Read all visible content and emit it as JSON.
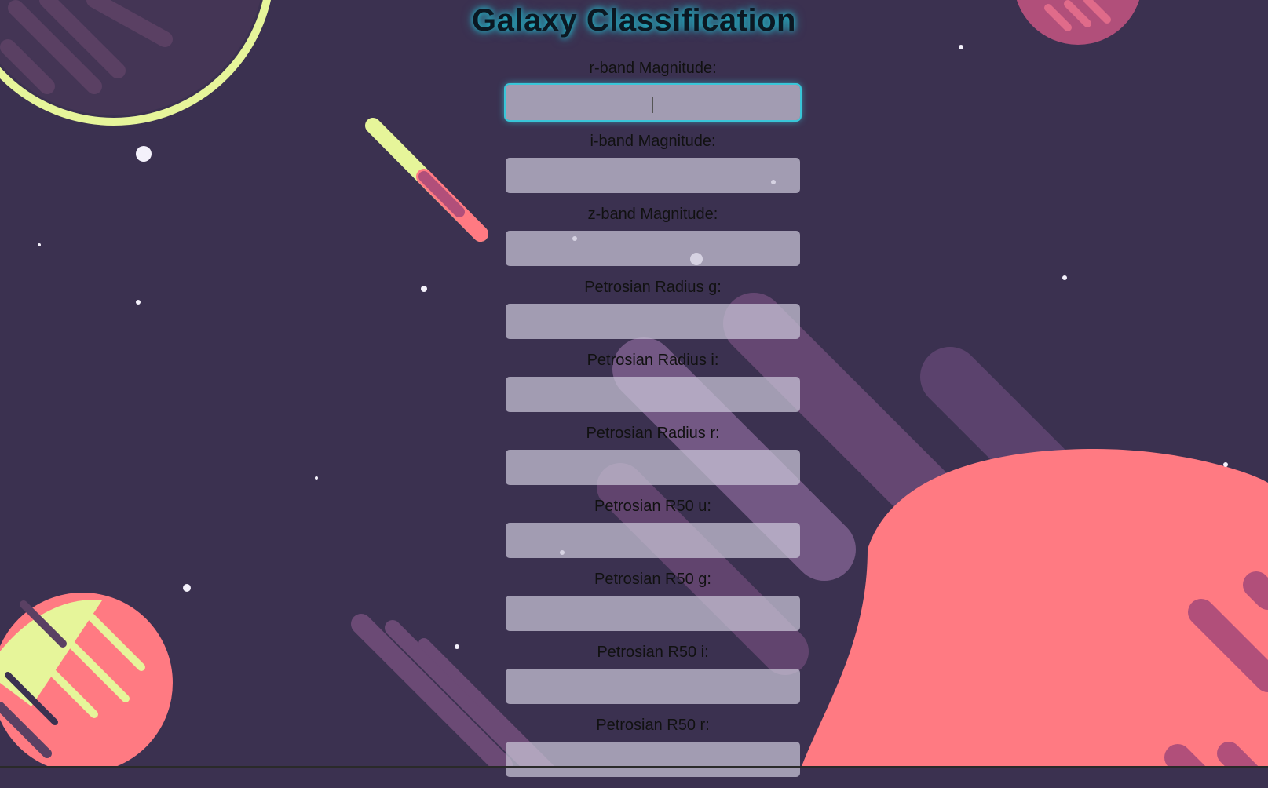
{
  "page": {
    "title": "Galaxy Classification"
  },
  "form": {
    "fields": [
      {
        "label": "r-band Magnitude:",
        "value": "",
        "focused": true
      },
      {
        "label": "i-band Magnitude:",
        "value": ""
      },
      {
        "label": "z-band Magnitude:",
        "value": ""
      },
      {
        "label": "Petrosian Radius g:",
        "value": ""
      },
      {
        "label": "Petrosian Radius i:",
        "value": ""
      },
      {
        "label": "Petrosian Radius r:",
        "value": ""
      },
      {
        "label": "Petrosian R50 u:",
        "value": ""
      },
      {
        "label": "Petrosian R50 g:",
        "value": ""
      },
      {
        "label": "Petrosian R50 i:",
        "value": ""
      },
      {
        "label": "Petrosian R50 r:",
        "value": ""
      }
    ]
  },
  "theme": {
    "background": "#3b3150",
    "planet_coral": "#ff7a82",
    "accent_lime": "#e6f59a",
    "streak_purple": "#6b4a75",
    "focus_glow": "#39c6d8"
  }
}
